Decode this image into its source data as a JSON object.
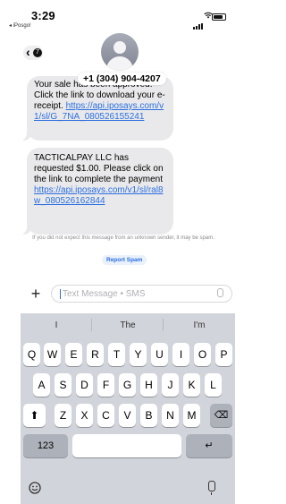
{
  "status_bar": {
    "time": "3:29",
    "back_app": "◂ iPosgo!"
  },
  "nav": {
    "back_badge": "7",
    "contact": "+1 (304) 904-4207"
  },
  "messages": [
    {
      "text": "Your sale has been approved. Click the link to download your e-receipt.",
      "link": "https://api.iposays.com/v1/sl/G_7NA_080526155241"
    },
    {
      "text": "TACTICALPAY LLC has requested $1.00.  Please click on the link to complete the payment",
      "link": "https://api.iposays.com/v1/sl/ral8w_080526162844"
    }
  ],
  "notice": "If you did not expect this message from an unknown sender, it may be spam.",
  "report_spam": "Report Spam",
  "compose": {
    "placeholder": "Text Message • SMS"
  },
  "keyboard": {
    "suggestions": [
      "I",
      "The",
      "I'm"
    ],
    "row1": [
      "Q",
      "W",
      "E",
      "R",
      "T",
      "Y",
      "U",
      "I",
      "O",
      "P"
    ],
    "row2": [
      "A",
      "S",
      "D",
      "F",
      "G",
      "H",
      "J",
      "K",
      "L"
    ],
    "row3": [
      "Z",
      "X",
      "C",
      "V",
      "B",
      "N",
      "M"
    ],
    "numbers_key": "123",
    "return_key": "↵",
    "shift_key": "⬆",
    "delete_key": "⌫"
  }
}
